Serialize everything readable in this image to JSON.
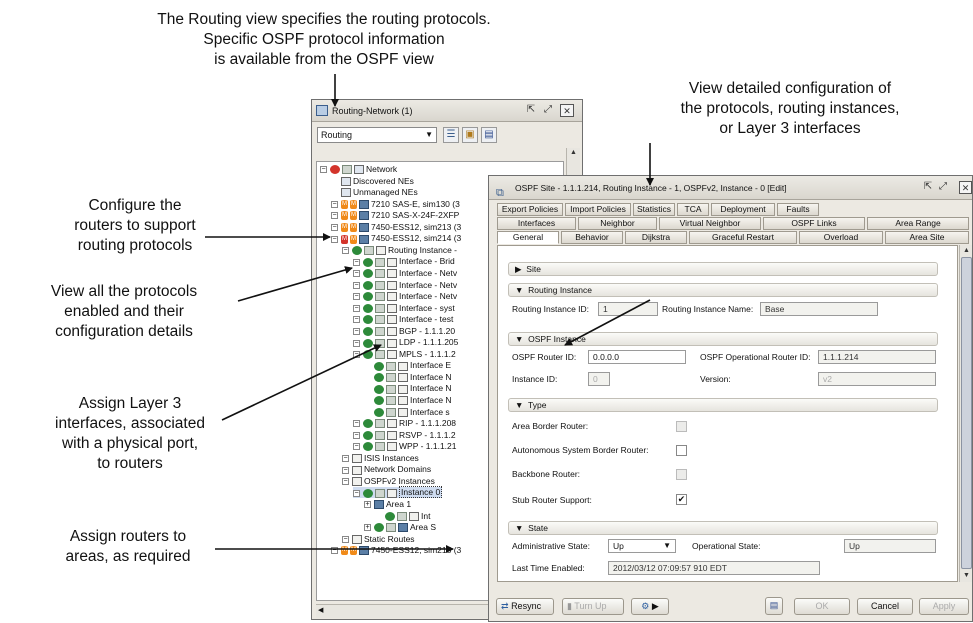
{
  "annotations": {
    "top": [
      "The Routing view specifies the routing protocols.",
      "Specific OSPF protocol information",
      "is available from the OSPF view"
    ],
    "configure": [
      "Configure the",
      "routers to support",
      "routing protocols"
    ],
    "view_all": [
      "View all the protocols",
      "enabled and their",
      "configuration details"
    ],
    "assign_l3": [
      "Assign Layer 3",
      "interfaces, associated",
      "with a physical port,",
      "to routers"
    ],
    "assign_areas": [
      "Assign routers to",
      "areas, as required"
    ],
    "view_detailed": [
      "View detailed configuration of",
      "the protocols, routing instances,",
      "or Layer 3 interfaces"
    ]
  },
  "nav_window": {
    "title": "Routing-Network (1)",
    "view_select": "Routing",
    "icon_buttons": [
      "filter-icon",
      "properties-icon",
      "save-icon"
    ],
    "tree": [
      {
        "label": "Network",
        "indent": 0,
        "icon": "network-icon",
        "status": "red"
      },
      {
        "label": "Discovered NEs",
        "indent": 1,
        "icon": "folder-icon",
        "status": "none"
      },
      {
        "label": "Unmanaged NEs",
        "indent": 1,
        "icon": "folder-icon",
        "status": "none"
      },
      {
        "label": "7210 SAS-E, sim130 (3",
        "indent": 1,
        "icon": "router-icon",
        "status": "mm"
      },
      {
        "label": "7210 SAS-X-24F-2XFP",
        "indent": 1,
        "icon": "router-icon",
        "status": "mm"
      },
      {
        "label": "7450-ESS12, sim213 (3",
        "indent": 1,
        "icon": "router-icon",
        "status": "mm"
      },
      {
        "label": "7450-ESS12, sim214 (3",
        "indent": 1,
        "icon": "router-icon",
        "status": "rm"
      },
      {
        "label": "Routing Instance -",
        "indent": 2,
        "icon": "routing-instance-icon",
        "status": "green"
      },
      {
        "label": "Interface - Brid",
        "indent": 3,
        "icon": "interface-icon",
        "status": "green"
      },
      {
        "label": "Interface - Netv",
        "indent": 3,
        "icon": "interface-icon",
        "status": "green"
      },
      {
        "label": "Interface - Netv",
        "indent": 3,
        "icon": "interface-icon",
        "status": "green"
      },
      {
        "label": "Interface - Netv",
        "indent": 3,
        "icon": "interface-icon",
        "status": "green"
      },
      {
        "label": "Interface - syst",
        "indent": 3,
        "icon": "interface-icon",
        "status": "green"
      },
      {
        "label": "Interface - test",
        "indent": 3,
        "icon": "interface-icon",
        "status": "green"
      },
      {
        "label": "BGP - 1.1.1.20",
        "indent": 3,
        "icon": "protocol-icon",
        "status": "green"
      },
      {
        "label": "LDP - 1.1.1.205",
        "indent": 3,
        "icon": "protocol-icon",
        "status": "green"
      },
      {
        "label": "MPLS - 1.1.1.2",
        "indent": 3,
        "icon": "protocol-icon",
        "status": "green"
      },
      {
        "label": "Interface E",
        "indent": 4,
        "icon": "interface-icon",
        "status": "green"
      },
      {
        "label": "Interface N",
        "indent": 4,
        "icon": "interface-icon",
        "status": "green"
      },
      {
        "label": "Interface N",
        "indent": 4,
        "icon": "interface-icon",
        "status": "green"
      },
      {
        "label": "Interface N",
        "indent": 4,
        "icon": "interface-icon",
        "status": "green"
      },
      {
        "label": "Interface s",
        "indent": 4,
        "icon": "interface-icon",
        "status": "green"
      },
      {
        "label": "RIP - 1.1.1.208",
        "indent": 3,
        "icon": "protocol-icon",
        "status": "green"
      },
      {
        "label": "RSVP - 1.1.1.2",
        "indent": 3,
        "icon": "protocol-icon",
        "status": "green"
      },
      {
        "label": "WPP - 1.1.1.21",
        "indent": 3,
        "icon": "protocol-icon",
        "status": "green"
      },
      {
        "label": "ISIS Instances",
        "indent": 2,
        "icon": "isis-icon",
        "status": "none"
      },
      {
        "label": "Network Domains",
        "indent": 2,
        "icon": "domain-icon",
        "status": "none"
      },
      {
        "label": "OSPFv2 Instances",
        "indent": 2,
        "icon": "ospf-icon",
        "status": "none"
      },
      {
        "label": "Instance 0",
        "indent": 3,
        "icon": "protocol-icon",
        "status": "green",
        "selected": true
      },
      {
        "label": "Area 1",
        "indent": 4,
        "icon": "area-icon",
        "status": "none"
      },
      {
        "label": "Int",
        "indent": 5,
        "icon": "interface-icon",
        "status": "green"
      },
      {
        "label": "Area S",
        "indent": 4,
        "icon": "area-icon",
        "status": "green"
      },
      {
        "label": "Static Routes",
        "indent": 2,
        "icon": "static-icon",
        "status": "none"
      },
      {
        "label": "7450-ESS12, sim215 (3",
        "indent": 1,
        "icon": "router-icon",
        "status": "mm"
      }
    ]
  },
  "dialog": {
    "title": "OSPF Site - 1.1.1.214, Routing Instance - 1, OSPFv2, Instance - 0 [Edit]",
    "tabs_row1": [
      "Export Policies",
      "Import Policies",
      "Statistics",
      "TCA",
      "Deployment",
      "Faults"
    ],
    "tabs_row2": [
      "Interfaces",
      "Neighbor",
      "Virtual Neighbor",
      "OSPF Links",
      "Area Range"
    ],
    "tabs_row3": [
      "General",
      "Behavior",
      "Dijkstra",
      "Graceful Restart",
      "Overload",
      "Area Site"
    ],
    "site_header": "Site",
    "routing_instance": {
      "header": "Routing Instance",
      "id_label": "Routing Instance ID:",
      "id_value": "1",
      "name_label": "Routing Instance Name:",
      "name_value": "Base"
    },
    "ospf_instance": {
      "header": "OSPF Instance",
      "router_id_label": "OSPF Router ID:",
      "router_id_value": "0.0.0.0",
      "op_router_id_label": "OSPF Operational Router ID:",
      "op_router_id_value": "1.1.1.214",
      "instance_id_label": "Instance ID:",
      "instance_id_value": "0",
      "version_label": "Version:",
      "version_value": "v2"
    },
    "type": {
      "header": "Type",
      "area_border_label": "Area Border Router:",
      "asbr_label": "Autonomous System Border Router:",
      "backbone_label": "Backbone Router:",
      "stub_label": "Stub Router Support:",
      "stub_checked": "✔"
    },
    "state": {
      "header": "State",
      "admin_label": "Administrative State:",
      "admin_value": "Up",
      "oper_label": "Operational State:",
      "oper_value": "Up",
      "last_enabled_label": "Last Time Enabled:",
      "last_enabled_value": "2012/03/12 07:09:57 910 EDT"
    },
    "buttons": {
      "resync": "Resync",
      "turn_up": "Turn Up",
      "ok": "OK",
      "cancel": "Cancel",
      "apply": "Apply"
    }
  }
}
